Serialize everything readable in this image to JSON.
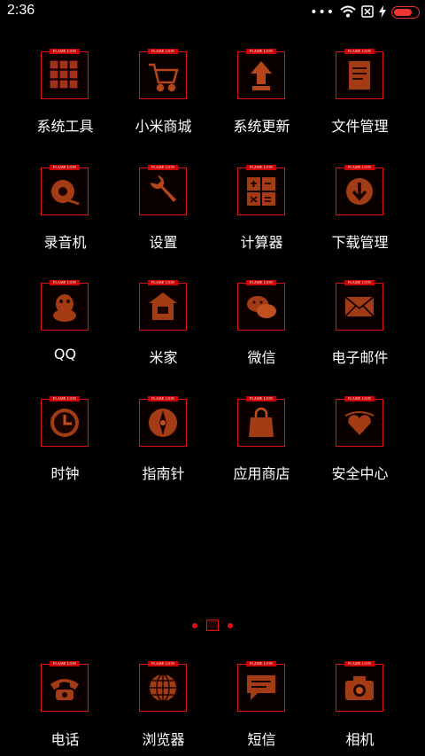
{
  "status_bar": {
    "time": "2:36",
    "icons": [
      "more-dots-icon",
      "wifi-icon",
      "no-sim-icon",
      "charging-bolt-icon",
      "battery-icon"
    ]
  },
  "brand_tag": "FLAME LION",
  "apps": [
    {
      "label": "系统工具",
      "icon": "folder-grid-icon"
    },
    {
      "label": "小米商城",
      "icon": "shopping-cart-icon"
    },
    {
      "label": "系统更新",
      "icon": "arrow-up-icon"
    },
    {
      "label": "文件管理",
      "icon": "file-icon"
    },
    {
      "label": "录音机",
      "icon": "tape-recorder-icon"
    },
    {
      "label": "设置",
      "icon": "wrench-icon"
    },
    {
      "label": "计算器",
      "icon": "calculator-icon"
    },
    {
      "label": "下载管理",
      "icon": "download-icon"
    },
    {
      "label": "QQ",
      "icon": "penguin-icon"
    },
    {
      "label": "米家",
      "icon": "home-icon"
    },
    {
      "label": "微信",
      "icon": "chat-bubbles-icon"
    },
    {
      "label": "电子邮件",
      "icon": "envelope-icon"
    },
    {
      "label": "时钟",
      "icon": "clock-icon"
    },
    {
      "label": "指南针",
      "icon": "compass-icon"
    },
    {
      "label": "应用商店",
      "icon": "bag-icon"
    },
    {
      "label": "安全中心",
      "icon": "heart-shield-icon"
    }
  ],
  "dock": [
    {
      "label": "电话",
      "icon": "phone-icon"
    },
    {
      "label": "浏览器",
      "icon": "globe-icon"
    },
    {
      "label": "短信",
      "icon": "message-icon"
    },
    {
      "label": "相机",
      "icon": "camera-icon"
    }
  ],
  "colors": {
    "accent": "#e01010",
    "background": "#000000",
    "icon_fill": "#8a2a10"
  }
}
